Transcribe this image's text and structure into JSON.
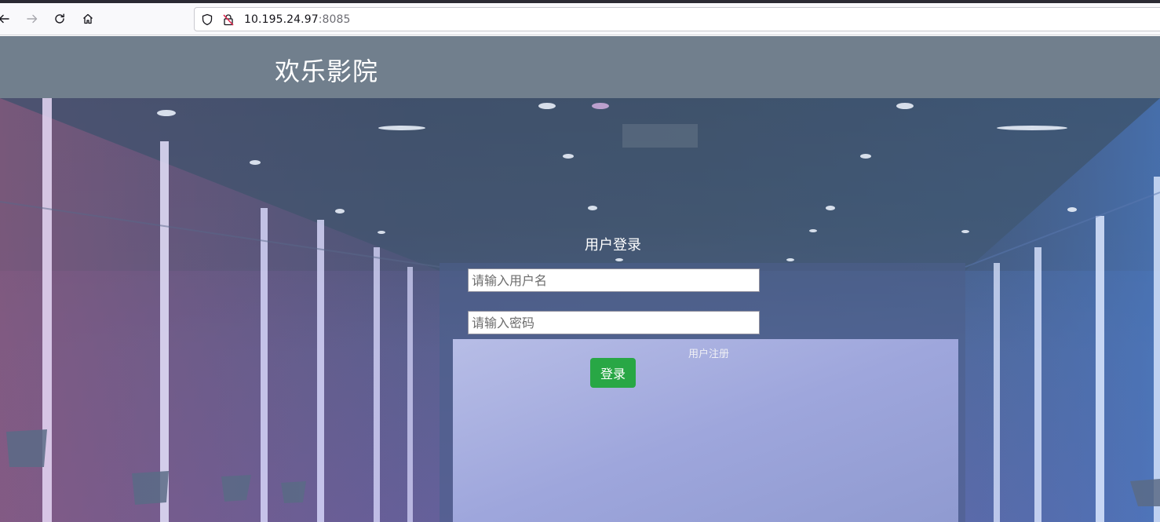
{
  "browser": {
    "url_host": "10.195.24.97",
    "url_port": ":8085"
  },
  "site": {
    "title": "欢乐影院"
  },
  "login": {
    "heading": "用户登录",
    "username_placeholder": "请输入用户名",
    "password_placeholder": "请输入密码",
    "register_link": "用户注册",
    "submit_label": "登录"
  },
  "colors": {
    "header_bg": "#717f8d",
    "button_green": "#28a745"
  }
}
